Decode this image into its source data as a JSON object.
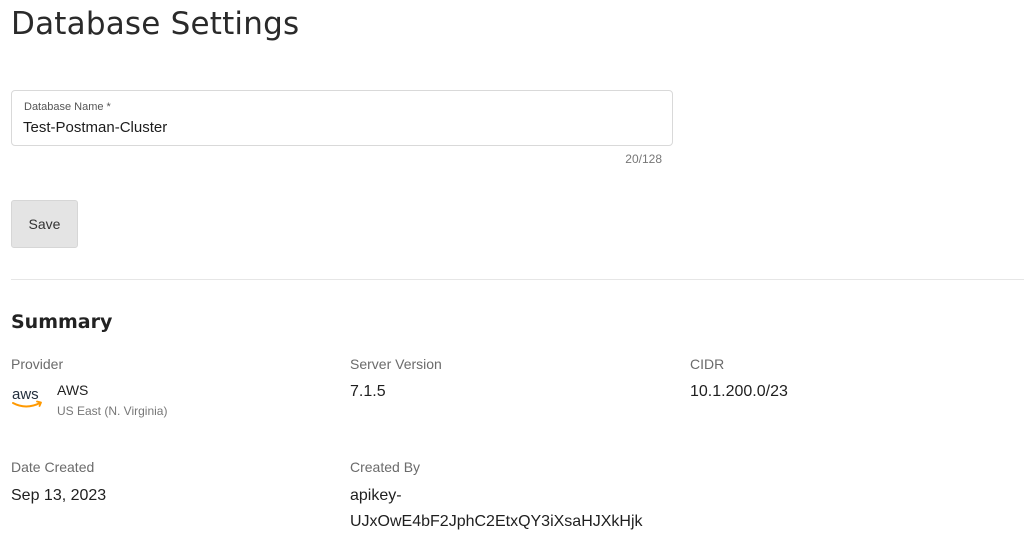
{
  "page": {
    "title": "Database Settings"
  },
  "form": {
    "name_label": "Database Name *",
    "name_value": "Test-Postman-Cluster",
    "char_count": "20/128",
    "save_label": "Save"
  },
  "summary": {
    "title": "Summary",
    "provider": {
      "label": "Provider",
      "logo_icon": "aws-logo-icon",
      "logo_text": "aws",
      "name": "AWS",
      "region": "US East (N. Virginia)"
    },
    "server_version": {
      "label": "Server Version",
      "value": "7.1.5"
    },
    "cidr": {
      "label": "CIDR",
      "value": "10.1.200.0/23"
    },
    "date_created": {
      "label": "Date Created",
      "value": "Sep 13, 2023"
    },
    "created_by": {
      "label": "Created By",
      "value_line1": "apikey-",
      "value_line2": "UJxOwE4bF2JphC2EtxQY3iXsaHJXkHjk"
    }
  },
  "colors": {
    "aws_smile": "#ff9900",
    "aws_text": "#232f3e"
  }
}
